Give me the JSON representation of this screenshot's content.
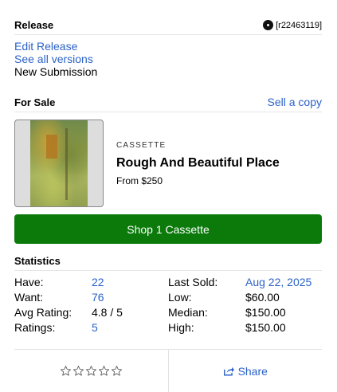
{
  "release": {
    "title": "Release",
    "id_label": "[r22463119]",
    "icon": "disc-icon",
    "links": [
      {
        "label": "Edit Release"
      },
      {
        "label": "See all versions"
      }
    ],
    "new_submission": "New Submission"
  },
  "for_sale": {
    "title": "For Sale",
    "sell_link": "Sell a copy",
    "item": {
      "format": "CASSETTE",
      "title": "Rough And Beautiful Place",
      "price": "From $250"
    },
    "shop_button": "Shop 1 Cassette",
    "shop_button_color": "#0b7a0b"
  },
  "statistics": {
    "title": "Statistics",
    "left": [
      {
        "label": "Have:",
        "value": "22"
      },
      {
        "label": "Want:",
        "value": "76"
      },
      {
        "label": "Avg Rating:",
        "value": "4.8 / 5"
      },
      {
        "label": "Ratings:",
        "value": "5"
      }
    ],
    "right": [
      {
        "label": "Last Sold:",
        "value": "Aug 22, 2025"
      },
      {
        "label": "Low:",
        "value": "$60.00"
      },
      {
        "label": "Median:",
        "value": "$150.00"
      },
      {
        "label": "High:",
        "value": "$150.00"
      }
    ]
  },
  "footer": {
    "rating_stars": 0,
    "rating_max": 5,
    "share_label": "Share",
    "share_icon": "share-icon"
  },
  "colors": {
    "link": "#2b62c8",
    "divider": "#e6e6e6"
  }
}
